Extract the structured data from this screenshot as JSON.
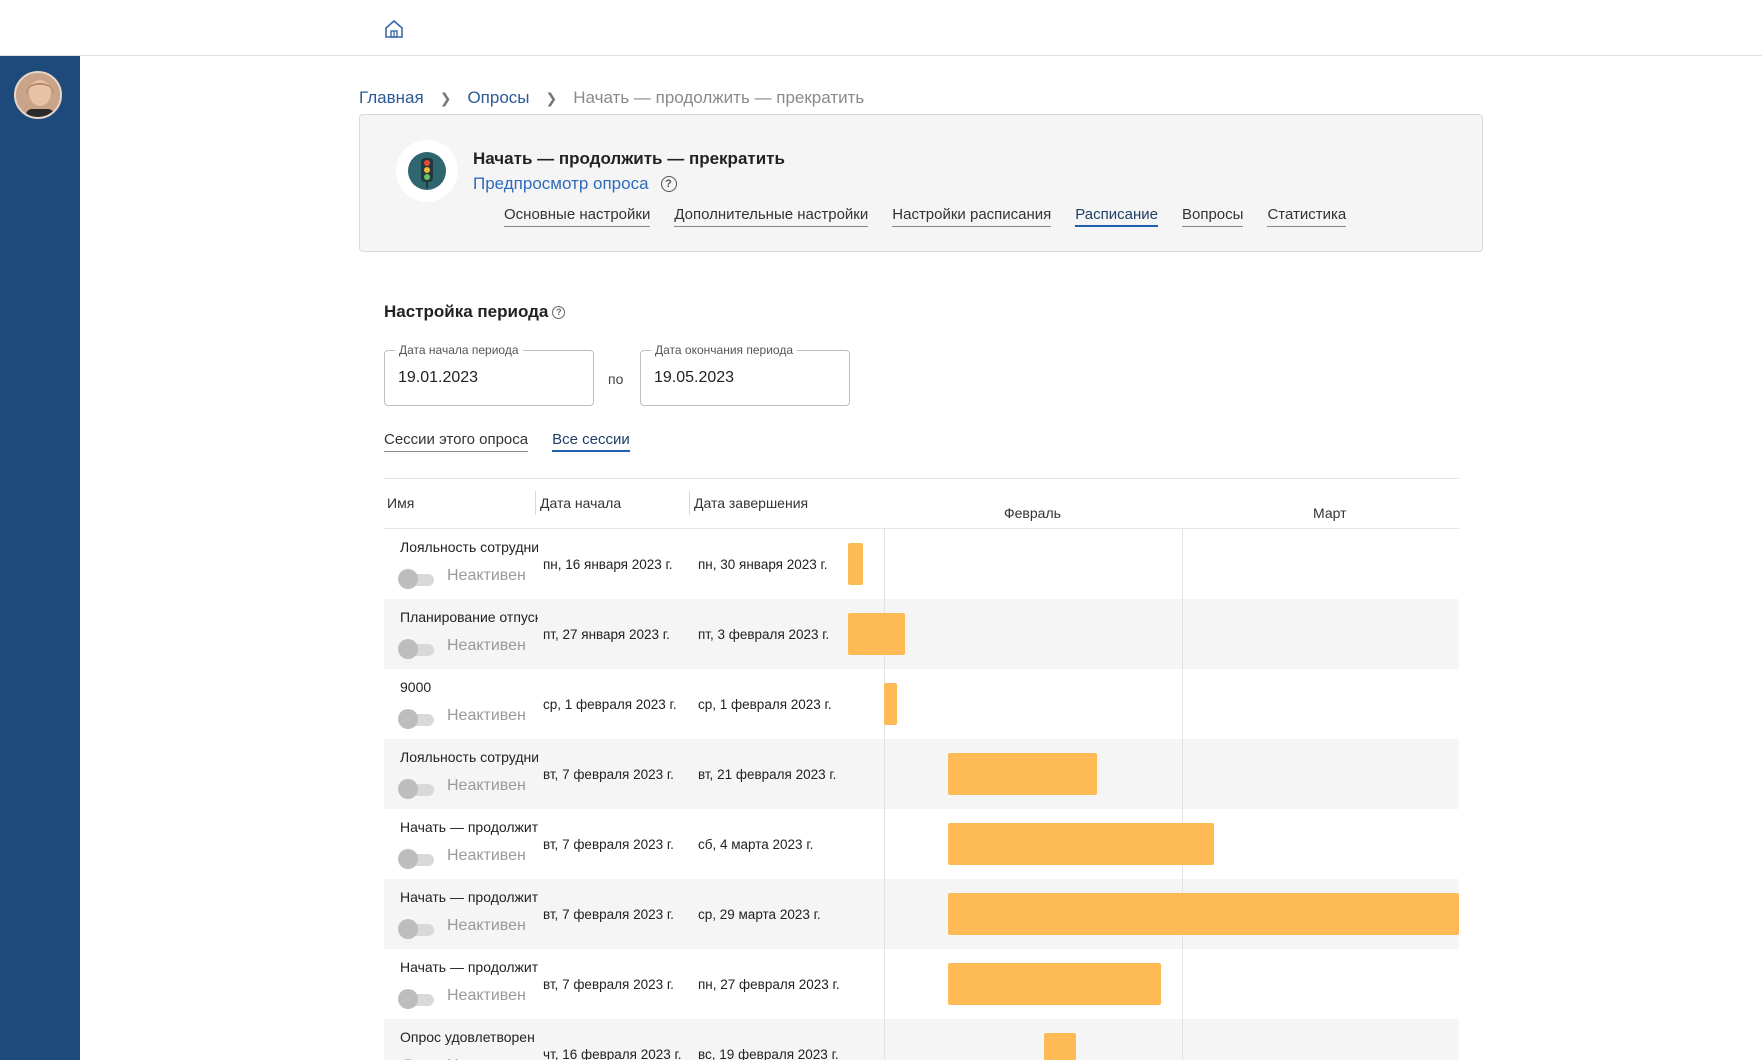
{
  "breadcrumb": {
    "home": "Главная",
    "surveys": "Опросы",
    "current": "Начать — продолжить — прекратить"
  },
  "card": {
    "title": "Начать — продолжить — прекратить",
    "preview": "Предпросмотр опроса",
    "help": "?",
    "tabs": [
      "Основные настройки",
      "Дополнительные настройки",
      "Настройки расписания",
      "Расписание",
      "Вопросы",
      "Статистика"
    ],
    "active_tab": "Расписание"
  },
  "period": {
    "title": "Настройка периода",
    "help": "?",
    "start_label": "Дата начала периода",
    "start_value": "19.01.2023",
    "separator": "по",
    "end_label": "Дата окончания периода",
    "end_value": "19.05.2023"
  },
  "subtabs": [
    "Сессии этого опроса",
    "Все сессии"
  ],
  "active_subtab": "Все сессии",
  "table": {
    "headers": {
      "name": "Имя",
      "start": "Дата начала",
      "end": "Дата завершения"
    },
    "months": [
      "Февраль",
      "Март"
    ],
    "rows": [
      {
        "name": "Лояльность сотрудни",
        "status": "Неактивен",
        "start": "пн, 16 января 2023 г.",
        "end": "пн, 30 января 2023 г."
      },
      {
        "name": "Планирование отпуск",
        "status": "Неактивен",
        "start": "пт, 27 января 2023 г.",
        "end": "пт, 3 февраля 2023 г."
      },
      {
        "name": "9000",
        "status": "Неактивен",
        "start": "ср, 1 февраля 2023 г.",
        "end": "ср, 1 февраля 2023 г."
      },
      {
        "name": "Лояльность сотрудни",
        "status": "Неактивен",
        "start": "вт, 7 февраля 2023 г.",
        "end": "вт, 21 февраля 2023 г."
      },
      {
        "name": "Начать — продолжит",
        "status": "Неактивен",
        "start": "вт, 7 февраля 2023 г.",
        "end": "сб, 4 марта 2023 г."
      },
      {
        "name": "Начать — продолжит",
        "status": "Неактивен",
        "start": "вт, 7 февраля 2023 г.",
        "end": "ср, 29 марта 2023 г."
      },
      {
        "name": "Начать — продолжит",
        "status": "Неактивен",
        "start": "вт, 7 февраля 2023 г.",
        "end": "пн, 27 февраля 2023 г."
      },
      {
        "name": "Опрос удовлетворен",
        "status": "Неактивен",
        "start": "чт, 16 февраля 2023 г.",
        "end": "вс, 19 февраля 2023 г."
      }
    ]
  },
  "colors": {
    "sidebar": "#1d4a7a",
    "bar": "#fdba55",
    "accent": "#1f5fae"
  }
}
